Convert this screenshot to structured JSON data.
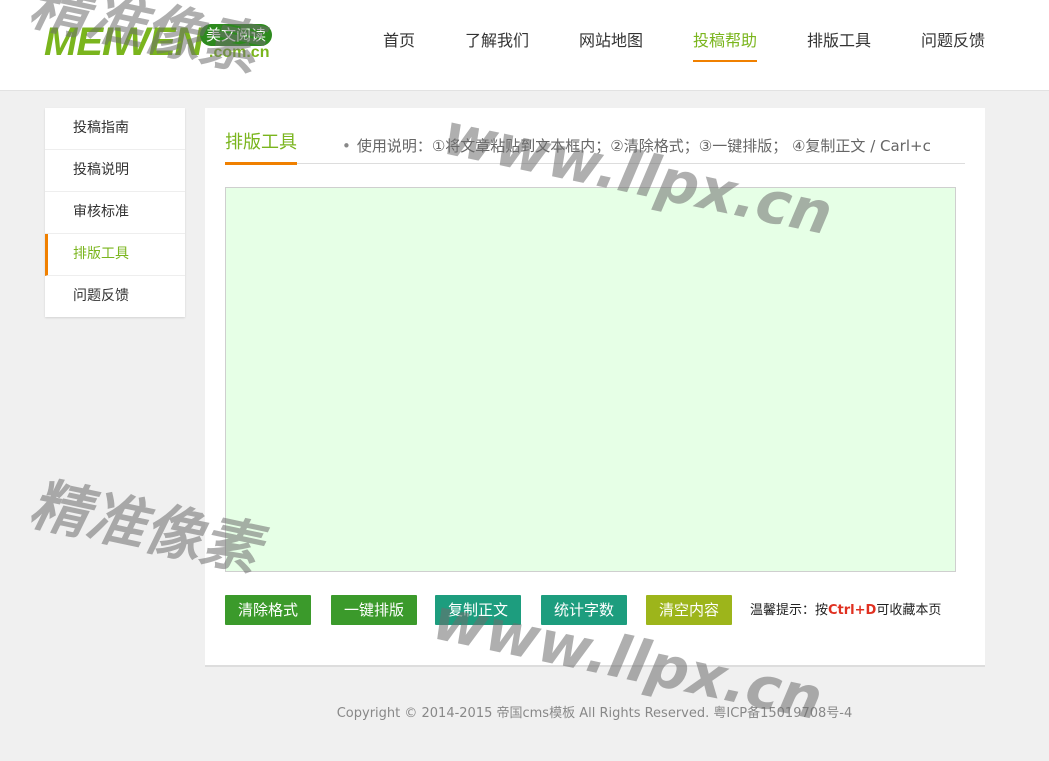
{
  "logo": {
    "brand": "MEIWEN",
    "badge": "美文阅读",
    "domain": ".com.cn"
  },
  "nav": [
    "首页",
    "了解我们",
    "网站地图",
    "投稿帮助",
    "排版工具",
    "问题反馈"
  ],
  "sidebar": [
    "投稿指南",
    "投稿说明",
    "审核标准",
    "排版工具",
    "问题反馈"
  ],
  "main": {
    "title": "排版工具",
    "instruction": "使用说明：①将文章粘贴到文本框内；②清除格式；③一键排版； ④复制正文 / Carl+c",
    "buttons": [
      "清除格式",
      "一键排版",
      "复制正文",
      "统计字数",
      "清空内容"
    ],
    "tip_prefix": "温馨提示：按",
    "tip_key": "Ctrl+D",
    "tip_suffix": "可收藏本页"
  },
  "footer": "Copyright © 2014-2015 帝国cms模板 All Rights Reserved. 粤ICP备15019708号-4",
  "watermark": {
    "cn": "精准像素",
    "url": "www.llpx.cn"
  },
  "colors": {
    "accent_green": "#7ab51d",
    "accent_orange": "#f08000",
    "editor_bg": "#e6ffe6"
  }
}
